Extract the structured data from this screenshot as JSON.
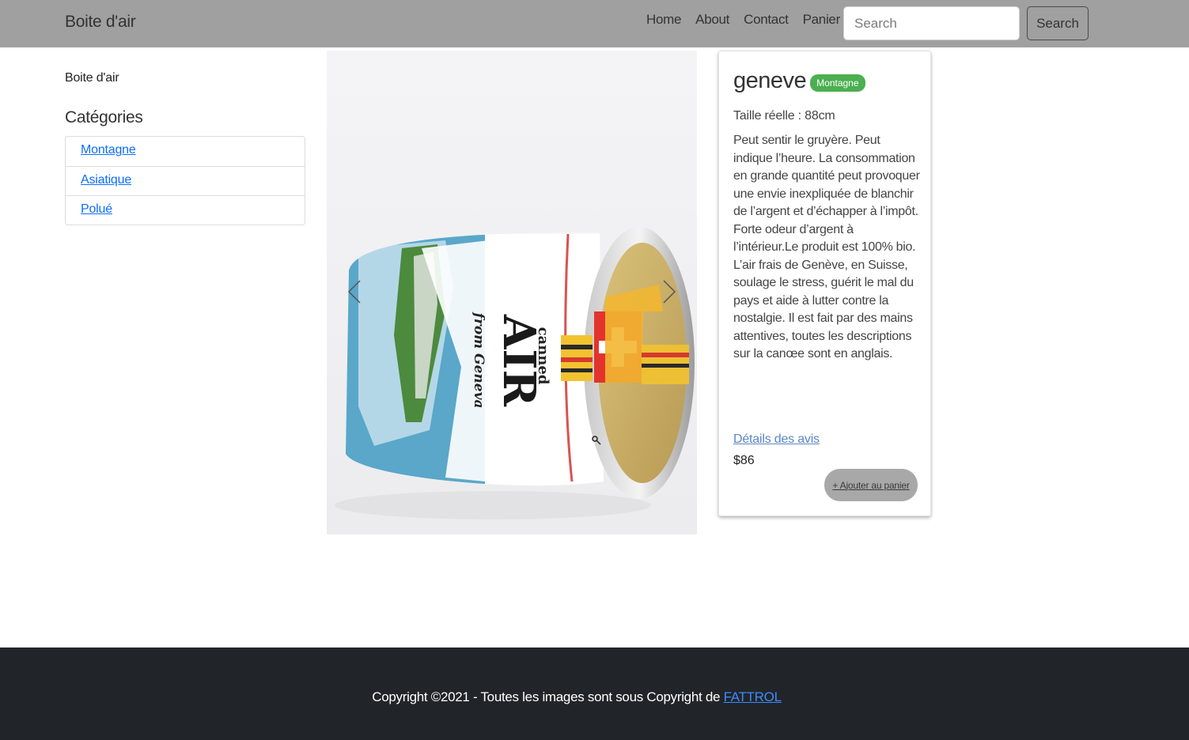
{
  "navbar": {
    "brand": "Boite d'air",
    "links": [
      "Home",
      "About",
      "Contact",
      "Panier"
    ],
    "search_placeholder": "Search",
    "search_button": "Search"
  },
  "sidebar": {
    "brand": "Boite d'air",
    "heading": "Catégories",
    "categories": [
      "Montagne",
      "Asiatique",
      "Polué"
    ]
  },
  "product": {
    "name": "geneve",
    "category_badge": "Montagne",
    "size": "Taille réelle : 88cm",
    "description": "Peut sentir le gruyère. Peut indique l’heure. La consommation en grande quantité peut provoquer une envie inexpliquée de blanchir de l’argent et d’échapper à l’impôt. Forte odeur d’argent à l’intérieur.Le produit est 100% bio. L’air frais de Genève, en Suisse, soulage le stress, guérit le mal du pays et aide à lutter contre la nostalgie. Il est fait par des mains attentives, toutes les descriptions sur la canœe sont en anglais.",
    "reviews_link": "Détails des avis",
    "price": "$86",
    "add_to_cart": "+ Ajouter au panier",
    "image_text": {
      "line1": "canned",
      "line2": "AIR",
      "line3": "from Geneva"
    }
  },
  "footer": {
    "text": "Copyright ©2021 - Toutes les images sont sous Copyright de ",
    "link": "FATTROL"
  },
  "colors": {
    "navbar_bg": "#a0a0a0",
    "badge_green": "#4caf50",
    "footer_bg": "#212529",
    "link_blue": "#0d6efd"
  }
}
